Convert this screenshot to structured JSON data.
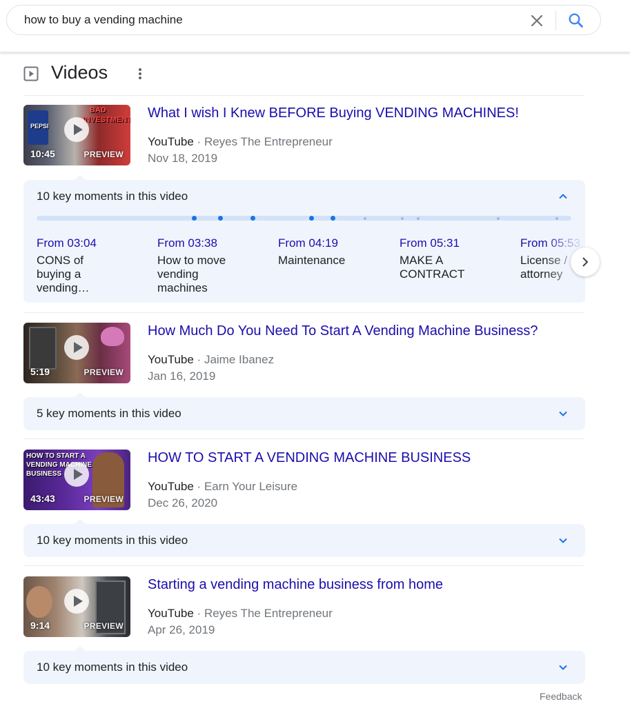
{
  "search": {
    "query": "how to buy a vending machine"
  },
  "section": {
    "title": "Videos"
  },
  "results": [
    {
      "title": "What I wish I Knew BEFORE Buying VENDING MACHINES!",
      "source": "YouTube",
      "separator": "·",
      "channel": "Reyes The Entrepreneur",
      "date": "Nov 18, 2019",
      "duration": "10:45",
      "preview": "PREVIEW",
      "thumb_text": [
        "BAD",
        "INVESTMENT!",
        "PEPSI"
      ],
      "key_moments": {
        "label": "10 key moments in this video",
        "expanded": true,
        "moments": [
          {
            "time": "From 03:04",
            "text": "CONS of buying a vending…"
          },
          {
            "time": "From 03:38",
            "text": "How to move vending machines"
          },
          {
            "time": "From 04:19",
            "text": "Maintenance"
          },
          {
            "time": "From 05:31",
            "text": "MAKE A CONTRACT"
          },
          {
            "time": "From 05:53",
            "text": "License / attorney"
          }
        ]
      }
    },
    {
      "title": "How Much Do You Need To Start A Vending Machine Business?",
      "source": "YouTube",
      "separator": "·",
      "channel": "Jaime Ibanez",
      "date": "Jan 16, 2019",
      "duration": "5:19",
      "preview": "PREVIEW",
      "key_moments": {
        "label": "5 key moments in this video",
        "expanded": false
      }
    },
    {
      "title": "HOW TO START A VENDING MACHINE BUSINESS",
      "source": "YouTube",
      "separator": "·",
      "channel": "Earn Your Leisure",
      "date": "Dec 26, 2020",
      "duration": "43:43",
      "preview": "PREVIEW",
      "thumb_text": [
        "HOW TO START A",
        "VENDING MACHINE",
        "BUSINESS"
      ],
      "key_moments": {
        "label": "10 key moments in this video",
        "expanded": false
      }
    },
    {
      "title": "Starting a vending machine business from home",
      "source": "YouTube",
      "separator": "·",
      "channel": "Reyes The Entrepreneur",
      "date": "Apr 26, 2019",
      "duration": "9:14",
      "preview": "PREVIEW",
      "key_moments": {
        "label": "10 key moments in this video",
        "expanded": false
      }
    }
  ],
  "footer": {
    "feedback": "Feedback"
  },
  "colors": {
    "link": "#1a0dab",
    "secondary_text": "#70757a",
    "panel_bg": "#f0f5fd",
    "accent": "#1a73e8"
  },
  "icons": [
    "clear-icon",
    "search-icon",
    "video-icon",
    "more-vert-icon",
    "chevron-up-icon",
    "chevron-down-icon",
    "chevron-right-icon",
    "play-icon"
  ]
}
